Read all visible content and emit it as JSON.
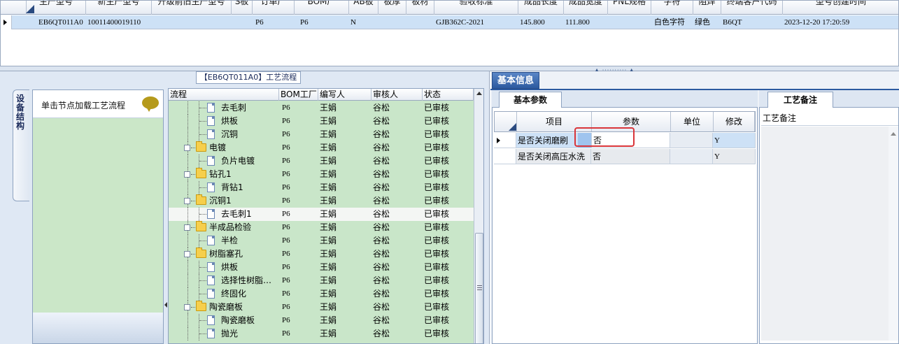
{
  "top_grid": {
    "columns": [
      "生产型号",
      "新生产型号",
      "升级前旧生产型号",
      "S板",
      "订单厂",
      "BOM厂",
      "AB板",
      "板厚",
      "板材",
      "验收标准",
      "成品长度",
      "成品宽度",
      "PNL规格",
      "字符",
      "阻焊",
      "终端客户代码",
      "型号创建时间"
    ],
    "row": [
      "EB6QT011A0",
      "10011400019110",
      "",
      "",
      "P6",
      "P6",
      "N",
      "",
      "",
      "GJB362C-2021",
      "145.800",
      "111.800",
      "",
      "白色字符",
      "绿色",
      "B6QT",
      "2023-12-20 17:20:59"
    ]
  },
  "splitter_grip": "▲ ·········· ▲",
  "left": {
    "process_title": "【EB6QT011A0】工艺流程",
    "side_tab": "设备结构",
    "hint_text": "单击节点加载工艺流程",
    "tree_headers": [
      "流程",
      "BOM工厂",
      "编写人",
      "审核人",
      "状态"
    ],
    "tree_rows": [
      {
        "level": 2,
        "type": "doc",
        "name": "去毛刺",
        "bom": "P6",
        "writer": "王娟",
        "reviewer": "谷松",
        "status": "已审核"
      },
      {
        "level": 2,
        "type": "doc",
        "name": "烘板",
        "bom": "P6",
        "writer": "王娟",
        "reviewer": "谷松",
        "status": "已审核"
      },
      {
        "level": 2,
        "type": "doc",
        "name": "沉铜",
        "bom": "P6",
        "writer": "王娟",
        "reviewer": "谷松",
        "status": "已审核"
      },
      {
        "level": 1,
        "type": "folder",
        "name": "电镀",
        "bom": "P6",
        "writer": "王娟",
        "reviewer": "谷松",
        "status": "已审核"
      },
      {
        "level": 2,
        "type": "doc",
        "name": "负片电镀",
        "bom": "P6",
        "writer": "王娟",
        "reviewer": "谷松",
        "status": "已审核"
      },
      {
        "level": 1,
        "type": "folder",
        "name": "钻孔1",
        "bom": "P6",
        "writer": "王娟",
        "reviewer": "谷松",
        "status": "已审核"
      },
      {
        "level": 2,
        "type": "doc",
        "name": "背钻1",
        "bom": "P6",
        "writer": "王娟",
        "reviewer": "谷松",
        "status": "已审核"
      },
      {
        "level": 1,
        "type": "folder",
        "name": "沉铜1",
        "bom": "P6",
        "writer": "王娟",
        "reviewer": "谷松",
        "status": "已审核"
      },
      {
        "level": 2,
        "type": "doc",
        "name": "去毛刺1",
        "bom": "P6",
        "writer": "王娟",
        "reviewer": "谷松",
        "status": "已审核",
        "selected": true
      },
      {
        "level": 1,
        "type": "folder",
        "name": "半成品检验",
        "bom": "P6",
        "writer": "王娟",
        "reviewer": "谷松",
        "status": "已审核"
      },
      {
        "level": 2,
        "type": "doc",
        "name": "半检",
        "bom": "P6",
        "writer": "王娟",
        "reviewer": "谷松",
        "status": "已审核"
      },
      {
        "level": 1,
        "type": "folder",
        "name": "树脂塞孔",
        "bom": "P6",
        "writer": "王娟",
        "reviewer": "谷松",
        "status": "已审核"
      },
      {
        "level": 2,
        "type": "doc",
        "name": "烘板",
        "bom": "P6",
        "writer": "王娟",
        "reviewer": "谷松",
        "status": "已审核"
      },
      {
        "level": 2,
        "type": "doc",
        "name": "选择性树脂…",
        "bom": "P6",
        "writer": "王娟",
        "reviewer": "谷松",
        "status": "已审核"
      },
      {
        "level": 2,
        "type": "doc",
        "name": "终固化",
        "bom": "P6",
        "writer": "王娟",
        "reviewer": "谷松",
        "status": "已审核"
      },
      {
        "level": 1,
        "type": "folder",
        "name": "陶瓷磨板",
        "bom": "P6",
        "writer": "王娟",
        "reviewer": "谷松",
        "status": "已审核"
      },
      {
        "level": 2,
        "type": "doc",
        "name": "陶瓷磨板",
        "bom": "P6",
        "writer": "王娟",
        "reviewer": "谷松",
        "status": "已审核"
      },
      {
        "level": 2,
        "type": "doc",
        "name": "抛光",
        "bom": "P6",
        "writer": "王娟",
        "reviewer": "谷松",
        "status": "已审核"
      }
    ]
  },
  "right": {
    "basic_tab": "基本信息",
    "params_tab": "基本参数",
    "param_headers": [
      "项目",
      "参数",
      "单位",
      "修改"
    ],
    "param_rows": [
      {
        "item": "是否关闭磨刷",
        "value": "否",
        "unit": "",
        "modify": "Y"
      },
      {
        "item": "是否关闭高压水洗",
        "value": "否",
        "unit": "",
        "modify": "Y"
      }
    ],
    "notes_tab": "工艺备注",
    "notes_label": "工艺备注"
  }
}
